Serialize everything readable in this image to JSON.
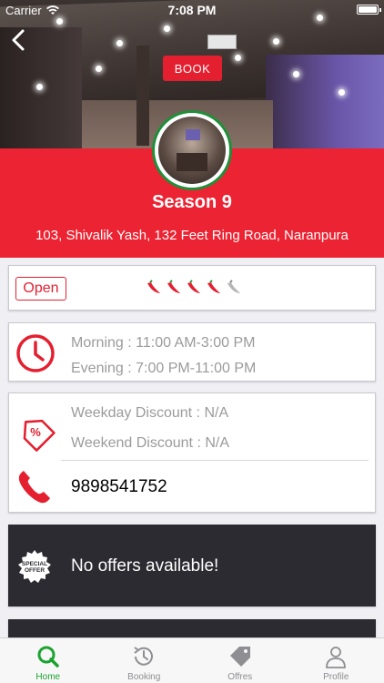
{
  "status_bar": {
    "carrier": "Carrier",
    "time": "7:08 PM"
  },
  "header": {
    "book_label": "BOOK"
  },
  "restaurant": {
    "name": "Season 9",
    "address": "103, Shivalik Yash, 132 Feet Ring Road, Naranpura",
    "status": "Open",
    "spice_level": 4,
    "spice_max": 5
  },
  "hours": {
    "morning": "Morning : 11:00 AM-3:00 PM",
    "evening": "Evening : 7:00 PM-11:00 PM"
  },
  "discount": {
    "weekday": "Weekday Discount : N/A",
    "weekend": "Weekend Discount : N/A"
  },
  "contact": {
    "phone": "9898541752"
  },
  "offers": {
    "badge_text": "SPECIAL OFFER",
    "message": "No offers available!"
  },
  "tabs": [
    {
      "label": "Home",
      "icon": "home-search-icon",
      "active": true
    },
    {
      "label": "Booking",
      "icon": "history-clock-icon",
      "active": false
    },
    {
      "label": "Offres",
      "icon": "price-tag-icon",
      "active": false
    },
    {
      "label": "Profile",
      "icon": "person-icon",
      "active": false
    }
  ],
  "colors": {
    "brand_red": "#ec2332",
    "active_green": "#1aa331",
    "dark_card": "#2b2b31"
  }
}
